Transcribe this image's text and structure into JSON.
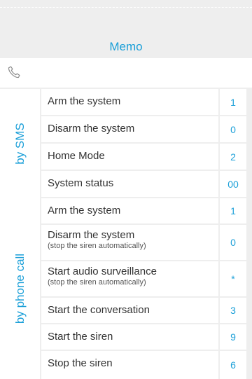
{
  "title": "Memo",
  "phone_icon": "phone-icon",
  "colors": {
    "accent": "#1a9fd8",
    "text": "#333333",
    "background": "#eeeeee"
  },
  "groups": [
    {
      "label": "by SMS",
      "rows": [
        {
          "cmd": "Arm the system",
          "sub": "",
          "code": "1"
        },
        {
          "cmd": "Disarm the system",
          "sub": "",
          "code": "0"
        },
        {
          "cmd": "Home Mode",
          "sub": "",
          "code": "2"
        },
        {
          "cmd": "System status",
          "sub": "",
          "code": "00"
        }
      ]
    },
    {
      "label": "by phone call",
      "rows": [
        {
          "cmd": "Arm the system",
          "sub": "",
          "code": "1"
        },
        {
          "cmd": "Disarm the system",
          "sub": "(stop the siren automatically)",
          "code": "0"
        },
        {
          "cmd": "Start audio surveillance",
          "sub": "(stop the siren automatically)",
          "code": "*"
        },
        {
          "cmd": "Start the conversation",
          "sub": "",
          "code": "3"
        },
        {
          "cmd": "Start the siren",
          "sub": "",
          "code": "9"
        },
        {
          "cmd": "Stop the siren",
          "sub": "",
          "code": "6"
        }
      ]
    }
  ]
}
